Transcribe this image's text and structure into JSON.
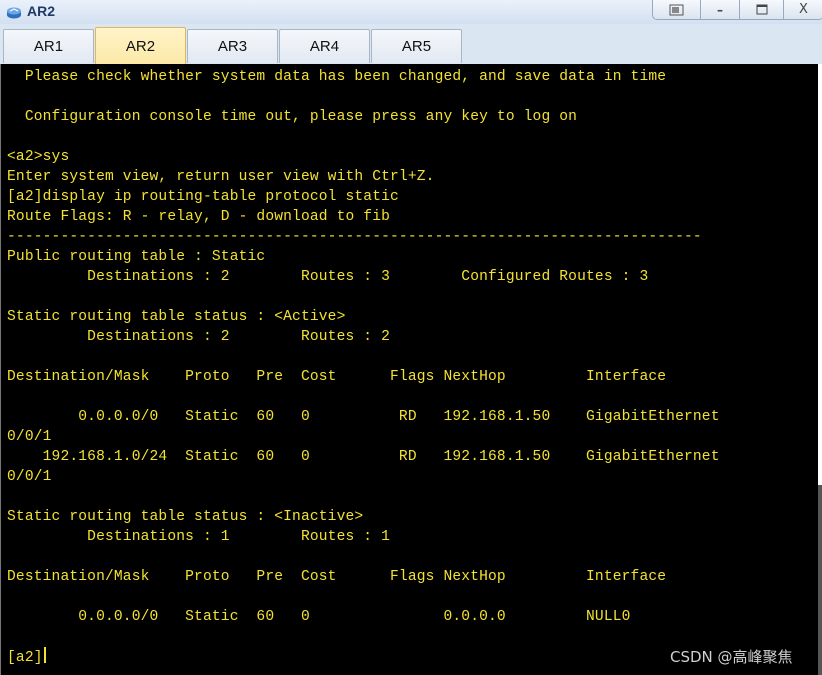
{
  "window": {
    "title": "AR2",
    "icon": "router-app-icon",
    "controls": {
      "restore": "restore-icon",
      "minimize": "–",
      "maximize": "maximize-icon",
      "close": "X"
    }
  },
  "tabs": [
    {
      "label": "AR1",
      "active": false
    },
    {
      "label": "AR2",
      "active": true
    },
    {
      "label": "AR3",
      "active": false
    },
    {
      "label": "AR4",
      "active": false
    },
    {
      "label": "AR5",
      "active": false
    }
  ],
  "console": {
    "text_color": "#f2e232",
    "background": "#000000",
    "lines": [
      "  Please check whether system data has been changed, and save data in time",
      "",
      "  Configuration console time out, please press any key to log on",
      "",
      "<a2>sys",
      "Enter system view, return user view with Ctrl+Z.",
      "[a2]display ip routing-table protocol static",
      "Route Flags: R - relay, D - download to fib",
      "------------------------------------------------------------------------------",
      "Public routing table : Static",
      "         Destinations : 2        Routes : 3        Configured Routes : 3",
      "",
      "Static routing table status : <Active>",
      "         Destinations : 2        Routes : 2",
      "",
      "Destination/Mask    Proto   Pre  Cost      Flags NextHop         Interface",
      "",
      "        0.0.0.0/0   Static  60   0          RD   192.168.1.50    GigabitEthernet",
      "0/0/1",
      "    192.168.1.0/24  Static  60   0          RD   192.168.1.50    GigabitEthernet",
      "0/0/1",
      "",
      "Static routing table status : <Inactive>",
      "         Destinations : 1        Routes : 1",
      "",
      "Destination/Mask    Proto   Pre  Cost      Flags NextHop         Interface",
      "",
      "        0.0.0.0/0   Static  60   0               0.0.0.0         NULL0",
      ""
    ],
    "prompt": "[a2]"
  },
  "watermark": "CSDN @高峰聚焦"
}
